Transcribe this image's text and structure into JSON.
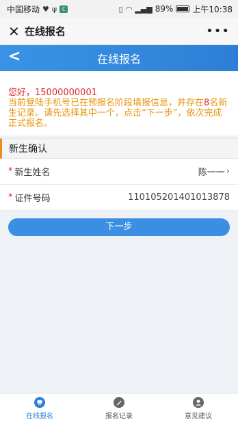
{
  "status_bar": {
    "carrier": "中国移动",
    "battery": "89%",
    "time": "上午10:38"
  },
  "webview": {
    "title": "在线报名"
  },
  "header": {
    "title": "在线报名"
  },
  "notice": {
    "greeting": "您好，15000000001",
    "message_part1": "当前登陆手机号已在预报名阶段填报信息，并存在",
    "count": "8",
    "message_part2": "名新生记录。请先选择其中一个，点击“下一步”，依次完成正式报名。"
  },
  "section": {
    "title": "新生确认"
  },
  "form": {
    "name_label": "新生姓名",
    "name_value": "陈一一",
    "id_label": "证件号码",
    "id_value": "110105201401013878"
  },
  "actions": {
    "next_label": "下一步"
  },
  "tabbar": {
    "tabs": [
      {
        "label": "在线报名"
      },
      {
        "label": "报名记录"
      },
      {
        "label": "意见建议"
      }
    ]
  },
  "colors": {
    "accent": "#2d7fd6",
    "warning": "#e8920a",
    "alert": "#e12b2b"
  }
}
